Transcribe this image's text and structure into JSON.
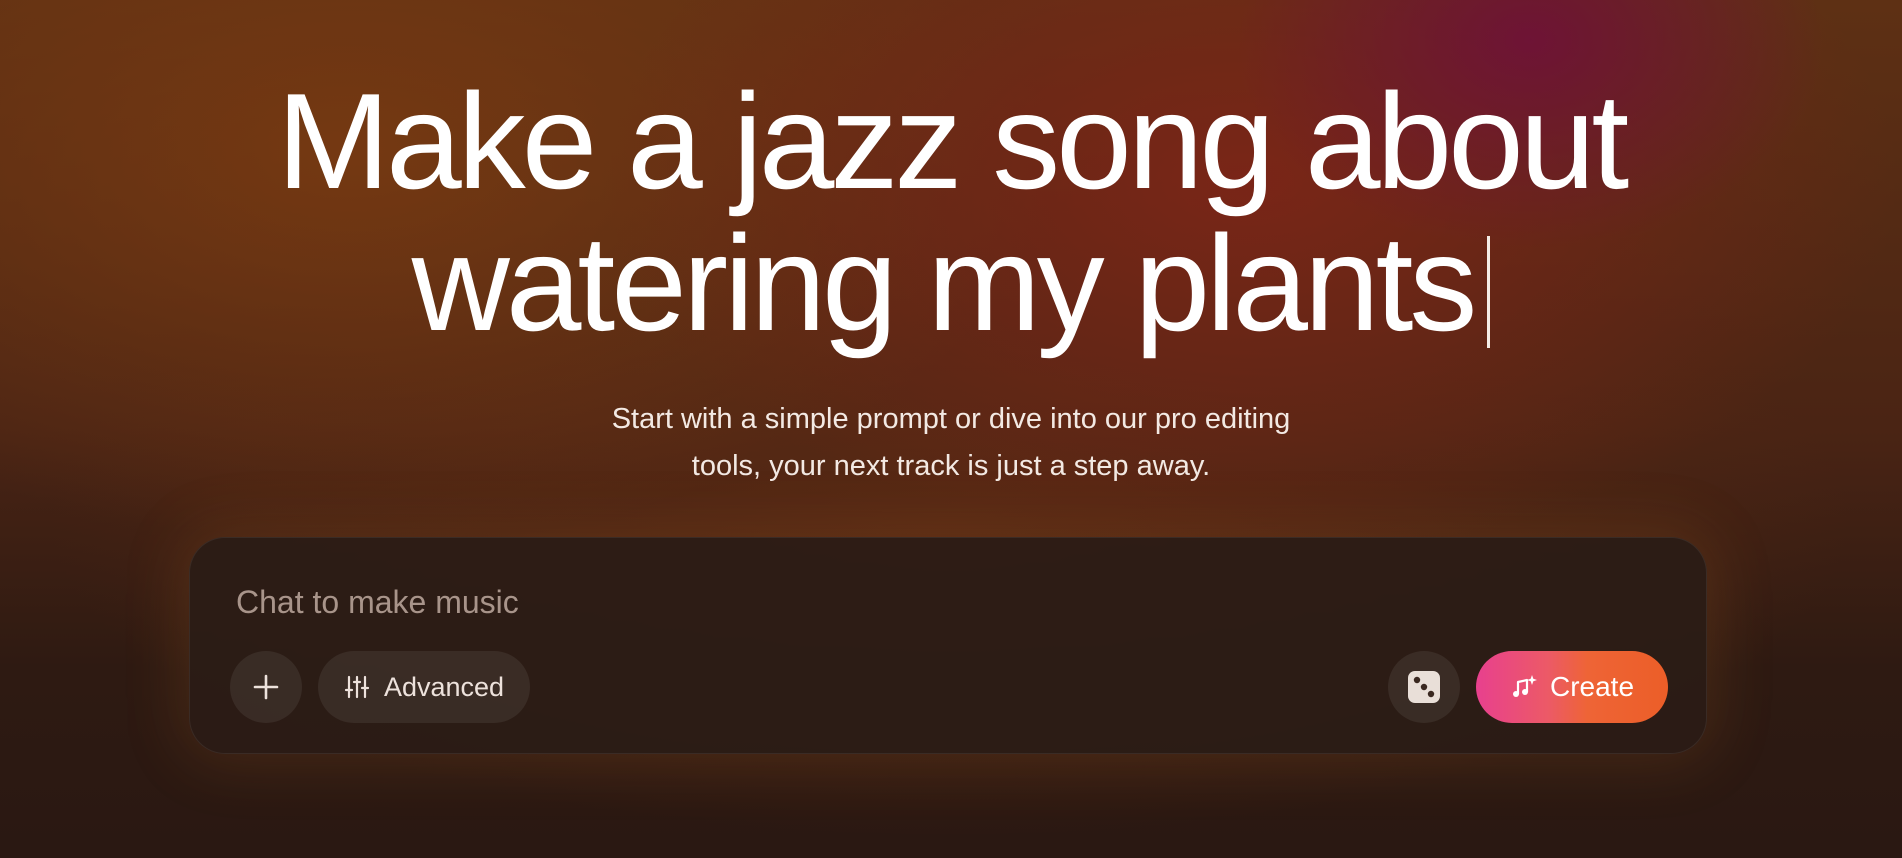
{
  "hero": {
    "headline_line1": "Make a jazz song about",
    "headline_line2": "watering my plants",
    "subtitle_line1": "Start with a simple prompt or dive into our pro editing",
    "subtitle_line2": "tools, your next track is just a step away."
  },
  "composer": {
    "placeholder": "Chat to make music",
    "value": "",
    "add_button_icon": "plus-icon",
    "advanced_label": "Advanced",
    "advanced_icon": "sliders-icon",
    "random_button_icon": "dice-icon",
    "create_label": "Create",
    "create_icon": "music-note-sparkle-icon"
  },
  "colors": {
    "create_gradient_start": "#e8408e",
    "create_gradient_end": "#ec5e28",
    "text_primary": "#ffffff",
    "placeholder": "#a8948a"
  }
}
